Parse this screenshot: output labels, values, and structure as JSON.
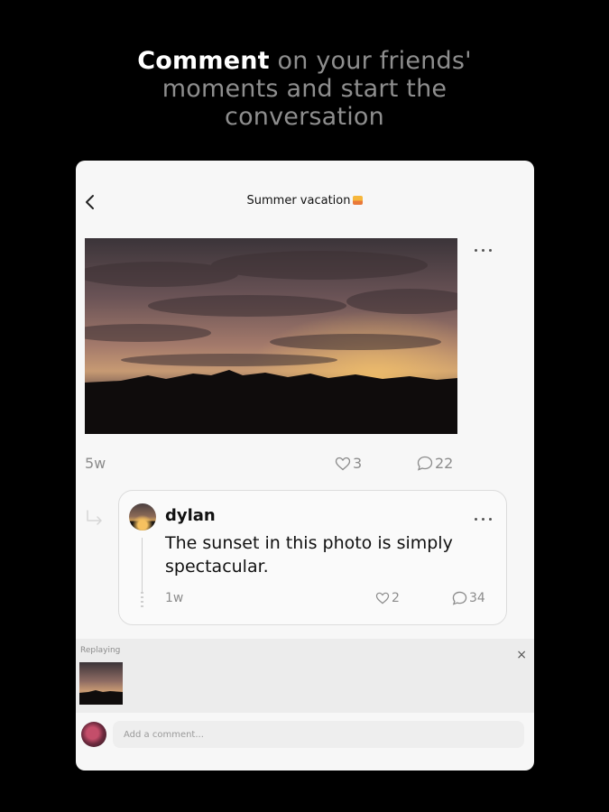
{
  "headline": {
    "strong": "Comment",
    "line1_rest": " on your friends'",
    "line2": "moments and start the",
    "line3": "conversation"
  },
  "post": {
    "title": "Summer vacation",
    "title_emoji_icon": "sunset-emoji-icon",
    "age": "5w",
    "likes": "3",
    "comments": "22"
  },
  "comment": {
    "username": "dylan",
    "text": "The sunset in this photo is simply spectacular.",
    "age": "1w",
    "likes": "2",
    "replies": "34"
  },
  "reply_panel": {
    "label": "Replaying",
    "close": "×"
  },
  "composer": {
    "placeholder": "Add a comment..."
  },
  "icons": [
    "back-chevron-icon",
    "more-dots-icon",
    "heart-icon",
    "speech-bubble-icon",
    "reply-arrow-icon",
    "close-icon"
  ],
  "colors": {
    "background": "#000000",
    "card": "#f7f7f7",
    "headline_strong": "#ffffff",
    "headline_muted": "#8e8e8e",
    "meta_text": "#8c8c8c"
  }
}
